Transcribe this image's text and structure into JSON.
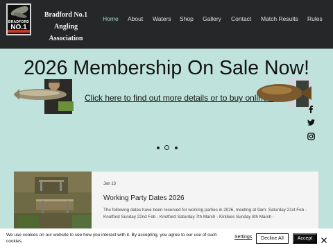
{
  "header": {
    "logo": {
      "top": "BRADFORD",
      "main": "NO.1",
      "icon": "leaping-fish-logo"
    },
    "brand_line1": "Bradford No.1 Angling",
    "brand_line2": "Association"
  },
  "nav": {
    "items": [
      {
        "label": "Home",
        "active": true
      },
      {
        "label": "About"
      },
      {
        "label": "Waters"
      },
      {
        "label": "Shop"
      },
      {
        "label": "Gallery"
      },
      {
        "label": "Contact"
      },
      {
        "label": "Match Results"
      },
      {
        "label": "Rules"
      }
    ]
  },
  "banner": {
    "title": "2026 Membership On Sale Now!",
    "link": "Click here to find out more details or to buy online..."
  },
  "social": {
    "icons": [
      "facebook-icon",
      "twitter-icon",
      "instagram-icon"
    ]
  },
  "slider": {
    "slide_count": 3,
    "active_index": 1
  },
  "post": {
    "date": "Jan 13",
    "title": "Working Party Dates 2026",
    "body": "The following dates have been reserved for working parties in 2026, meeting at 9am: Saturday 21st Feb - Knotford Sunday 22nd Feb - Knotford Saturday 7th March - Kirklees Sunday 8th March -"
  },
  "cookie": {
    "text": "We use cookies on our website to see how you interact with it. By accepting, you agree to our use of such cookies.",
    "settings": "Settings",
    "decline": "Decline All",
    "accept": "Accept"
  },
  "colors": {
    "header_bg": "#252728",
    "page_bg": "#bfe3dc",
    "active_nav": "#9ed9cb"
  }
}
